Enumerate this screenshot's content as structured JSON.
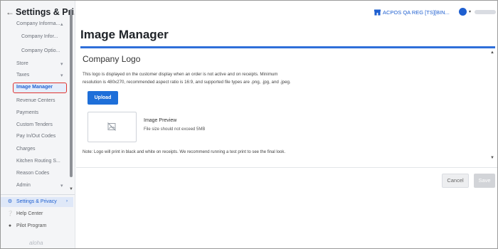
{
  "sidebar": {
    "back_icon": "arrow-left-icon",
    "title": "Settings & Pri...",
    "items": [
      {
        "label": "Company Informa...",
        "level": "top",
        "chevron": "▴"
      },
      {
        "label": "Company Infor...",
        "level": "sub"
      },
      {
        "label": "Company Optio...",
        "level": "sub"
      },
      {
        "label": "Store",
        "level": "top",
        "chevron": "▾"
      },
      {
        "label": "Taxes",
        "level": "top",
        "chevron": "▾"
      },
      {
        "label": "Image Manager",
        "level": "top",
        "active": true
      },
      {
        "label": "Revenue Centers",
        "level": "top"
      },
      {
        "label": "Payments",
        "level": "top"
      },
      {
        "label": "Custom Tenders",
        "level": "top"
      },
      {
        "label": "Pay In/Out Codes",
        "level": "top"
      },
      {
        "label": "Charges",
        "level": "top"
      },
      {
        "label": "Kitchen Routing S...",
        "level": "top"
      },
      {
        "label": "Reason Codes",
        "level": "top"
      },
      {
        "label": "Admin",
        "level": "top",
        "chevron": "▾"
      }
    ],
    "footer": [
      {
        "label": "Settings & Privacy",
        "icon": "gear-icon",
        "selected": true,
        "chevron": "›"
      },
      {
        "label": "Help Center",
        "icon": "help-icon",
        "selected": false
      },
      {
        "label": "Pilot Program",
        "icon": "pilot-icon",
        "selected": false
      }
    ],
    "brand": "aloha"
  },
  "topbar": {
    "store_label": "ACPOS QA REG [TS][BIN...",
    "store_icon": "store-icon",
    "user_icon": "user-avatar-icon",
    "user_chevron": "▾"
  },
  "main": {
    "page_title": "Image Manager",
    "section_title": "Company Logo",
    "description": "This logo is displayed on the customer display when an order is not active and on receipts. Minimum resolution is 480x270, recommended aspect ratio is 16:9, and supported file types are .png, .jpg, and .jpeg.",
    "upload_label": "Upload",
    "preview_title": "Image Preview",
    "preview_subtitle": "File size should not exceed 5MB",
    "note": "Note: Logo will print in black and white on receipts. We recommend running a test print to see the final look.",
    "cancel_label": "Cancel",
    "save_label": "Save"
  },
  "colors": {
    "accent": "#1e6fd9",
    "active_highlight": "#e0342f",
    "sidebar_bg": "#f4f5f7"
  }
}
